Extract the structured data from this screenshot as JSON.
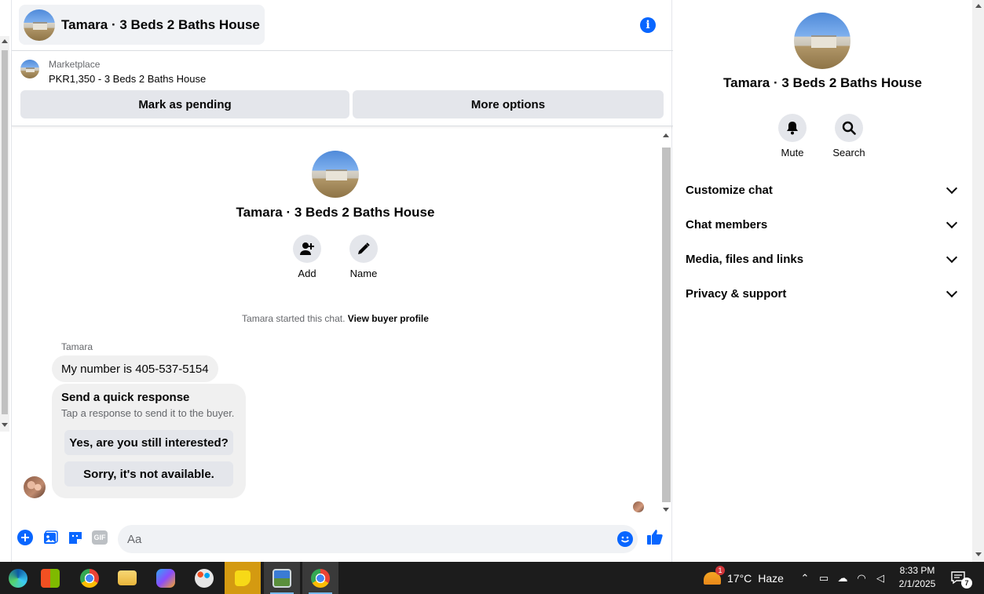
{
  "header": {
    "title": "Tamara · 3 Beds 2 Baths House",
    "info_icon": "info-icon"
  },
  "listing": {
    "source": "Marketplace",
    "price_title": "PKR1,350 - 3 Beds 2 Baths House",
    "mark_pending_label": "Mark as pending",
    "more_options_label": "More options"
  },
  "conversation": {
    "title": "Tamara · 3 Beds 2 Baths House",
    "add_label": "Add",
    "name_label": "Name",
    "started_text": "Tamara started this chat.",
    "view_buyer_label": "View buyer profile"
  },
  "messages": [
    {
      "sender": "Tamara",
      "text": "My number is 405-537-5154"
    }
  ],
  "quick_response": {
    "title": "Send a quick response",
    "subtitle": "Tap a response to send it to the buyer.",
    "options": [
      "Yes, are you still interested?",
      "Sorry, it's not available."
    ]
  },
  "composer": {
    "placeholder": "Aa",
    "gif_label": "GIF"
  },
  "sidebar": {
    "title": "Tamara · 3 Beds 2 Baths House",
    "mute_label": "Mute",
    "search_label": "Search",
    "sections": [
      "Customize chat",
      "Chat members",
      "Media, files and links",
      "Privacy & support"
    ]
  },
  "taskbar": {
    "weather_badge": "1",
    "temperature": "17°C",
    "condition": "Haze",
    "time": "8:33 PM",
    "date": "2/1/2025",
    "notification_count": "7"
  },
  "colors": {
    "accent": "#0866ff",
    "bubble": "#f0f0f0",
    "button": "#e4e6eb",
    "taskbar": "#1c1c1c"
  }
}
